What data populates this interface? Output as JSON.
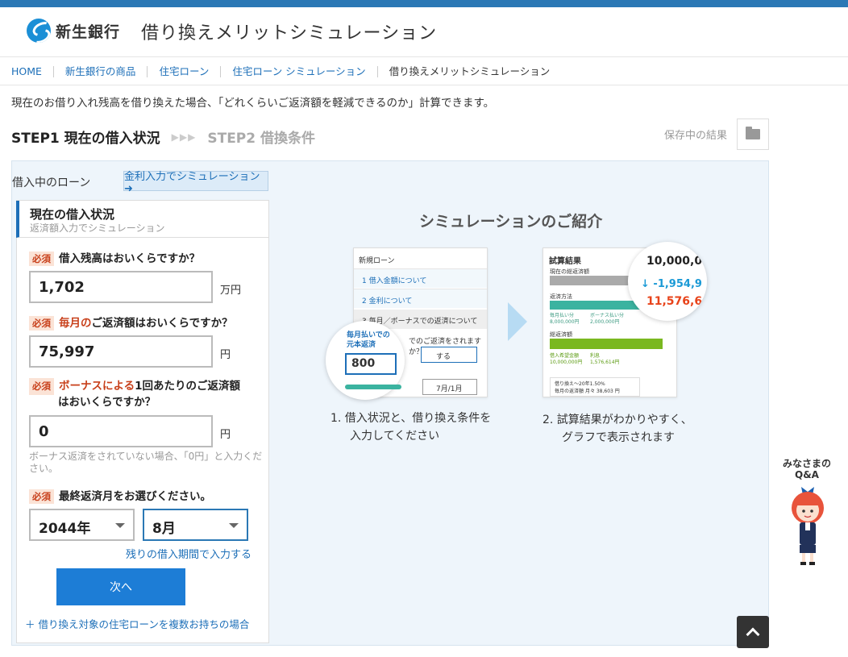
{
  "brand": {
    "name": "新生銀行"
  },
  "header": {
    "title": "借り換えメリットシミュレーション"
  },
  "breadcrumb": [
    "HOME",
    "新生銀行の商品",
    "住宅ローン",
    "住宅ローン シミュレーション",
    "借り換えメリットシミュレーション"
  ],
  "intro": "現在のお借り入れ残高を借り換えた場合、「どれくらいご返済額を軽減できるのか」計算できます。",
  "steps": {
    "step1": "STEP1 現在の借入状況",
    "arrows": "▶▶▶",
    "step2": "STEP2 借換条件"
  },
  "saved": {
    "label": "保存中の結果"
  },
  "form": {
    "loan_label": "借入中のローン",
    "rate_link": "金利入力でシミュレーション ➜",
    "panel_title": "現在の借入状況",
    "panel_sub": "返済額入力でシミュレーション",
    "required": "必須",
    "q1": "借入残高はおいくらですか？",
    "q1_value": "1,702",
    "q1_unit": "万円",
    "q2_hl": "毎月の",
    "q2_rest": "ご返済額はおいくらですか？",
    "q2_value": "75,997",
    "q2_unit": "円",
    "q3_hl": "ボーナスによる",
    "q3_rest": "1回あたりのご返済額",
    "q3_line2": "はおいくらですか？",
    "q3_value": "0",
    "q3_unit": "円",
    "bonus_note": "ボーナス返済をされていない場合、「0円」と入力ください。",
    "q4": "最終返済月をお選びください。",
    "year_value": "2044年",
    "month_value": "8月",
    "remain_link": "残りの借入期間で入力する",
    "next_button": "次へ",
    "multi_link": "＋ 借り換え対象の住宅ローンを複数お持ちの場合"
  },
  "intro_panel": {
    "title": "シミュレーションのご紹介",
    "step1_cap_l1": "1.  借入状況と、借り換え条件を",
    "step1_cap_l2": "入力してください",
    "step2_cap_l1": "2.  試算結果がわかりやすく、",
    "step2_cap_l2": "グラフで表示されます",
    "card1": {
      "title": "新規ローン",
      "item1": "1  借入金額について",
      "item2": "2  金利について",
      "item3": "3  毎月／ボーナスでの返済について",
      "q": "でのご返済をされますか？",
      "opt_yes": "する",
      "opt_month": "7月/1月",
      "bubble_l1": "毎月払いでの",
      "bubble_l2": "元本返済",
      "bubble_value": "800"
    },
    "card2": {
      "title": "試算結果",
      "l1": "現在の総返済額",
      "l2": "返済方法",
      "l3": "毎月払い分",
      "l3v": "8,000,000円",
      "l4": "ボーナス払い分",
      "l4v": "2,000,000円",
      "l5": "総返済額",
      "l6": "借入希望金額",
      "l6v": "10,000,000円",
      "l7": "利息",
      "l7v": "1,576,614円",
      "l8": "借り換え～20年1.50%",
      "l9": "毎月の返済額",
      "l9v": "月々 38,603 円",
      "bubble_v1": "10,000,0",
      "bubble_v2": "-1,954,9",
      "bubble_v3": "11,576,6"
    }
  },
  "side": {
    "qa_l1": "みなさまの",
    "qa_l2": "Q&A"
  },
  "colors": {
    "brand_blue": "#1d6fb8",
    "accent_red": "#c8401b",
    "next_button": "#1d7dd6"
  }
}
